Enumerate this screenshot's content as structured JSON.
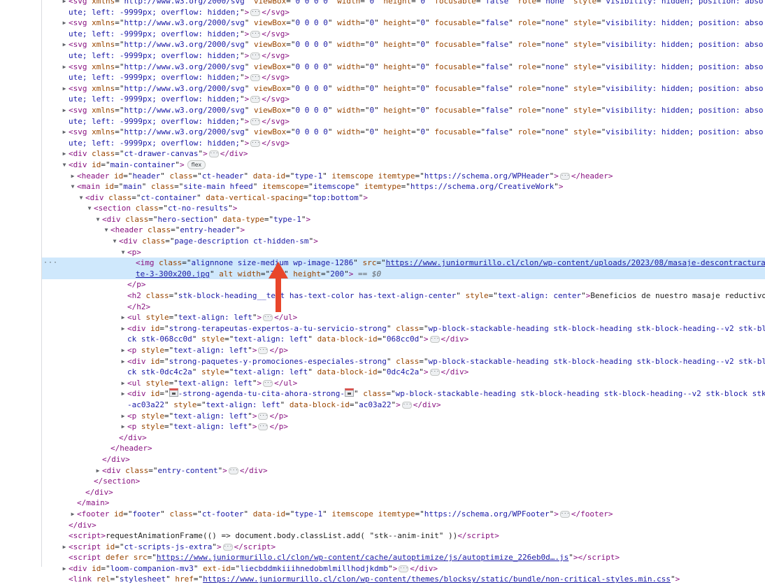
{
  "dom": {
    "rows": [
      {
        "i": 0,
        "t": "c",
        "h": "<span class=\"tag\">&lt;svg</span> <span class=\"an\">xmlns</span>=\"<span class=\"av\">http://www.w3.org/2000/svg</span>\" <span class=\"an\">viewBox</span>=\"<span class=\"av\">0 0 0 0</span>\" <span class=\"an\">width</span>=\"<span class=\"av\">0</span>\" <span class=\"an\">height</span>=\"<span class=\"av\">0</span>\" <span class=\"an\">focusable</span>=\"<span class=\"av\">false</span>\" <span class=\"an\">role</span>=\"<span class=\"av\">none</span>\" <span class=\"an\">style</span>=\"<span class=\"av\">visibility: hidden; position: abso</span>"
      },
      {
        "i": 0,
        "t": "",
        "h": "<span class=\"av\">ute; left: -9999px; overflow: hidden;</span>\"<span class=\"tag\">&gt;</span><span class=\"ell\">···</span><span class=\"tag\">&lt;/svg&gt;</span>"
      },
      {
        "i": 0,
        "t": "c",
        "h": "<span class=\"tag\">&lt;svg</span> <span class=\"an\">xmlns</span>=\"<span class=\"av\">http://www.w3.org/2000/svg</span>\" <span class=\"an\">viewBox</span>=\"<span class=\"av\">0 0 0 0</span>\" <span class=\"an\">width</span>=\"<span class=\"av\">0</span>\" <span class=\"an\">height</span>=\"<span class=\"av\">0</span>\" <span class=\"an\">focusable</span>=\"<span class=\"av\">false</span>\" <span class=\"an\">role</span>=\"<span class=\"av\">none</span>\" <span class=\"an\">style</span>=\"<span class=\"av\">visibility: hidden; position: abso</span>"
      },
      {
        "i": 0,
        "t": "",
        "h": "<span class=\"av\">ute; left: -9999px; overflow: hidden;</span>\"<span class=\"tag\">&gt;</span><span class=\"ell\">···</span><span class=\"tag\">&lt;/svg&gt;</span>"
      },
      {
        "i": 0,
        "t": "c",
        "h": "<span class=\"tag\">&lt;svg</span> <span class=\"an\">xmlns</span>=\"<span class=\"av\">http://www.w3.org/2000/svg</span>\" <span class=\"an\">viewBox</span>=\"<span class=\"av\">0 0 0 0</span>\" <span class=\"an\">width</span>=\"<span class=\"av\">0</span>\" <span class=\"an\">height</span>=\"<span class=\"av\">0</span>\" <span class=\"an\">focusable</span>=\"<span class=\"av\">false</span>\" <span class=\"an\">role</span>=\"<span class=\"av\">none</span>\" <span class=\"an\">style</span>=\"<span class=\"av\">visibility: hidden; position: abso</span>"
      },
      {
        "i": 0,
        "t": "",
        "h": "<span class=\"av\">ute; left: -9999px; overflow: hidden;</span>\"<span class=\"tag\">&gt;</span><span class=\"ell\">···</span><span class=\"tag\">&lt;/svg&gt;</span>"
      },
      {
        "i": 0,
        "t": "c",
        "h": "<span class=\"tag\">&lt;svg</span> <span class=\"an\">xmlns</span>=\"<span class=\"av\">http://www.w3.org/2000/svg</span>\" <span class=\"an\">viewBox</span>=\"<span class=\"av\">0 0 0 0</span>\" <span class=\"an\">width</span>=\"<span class=\"av\">0</span>\" <span class=\"an\">height</span>=\"<span class=\"av\">0</span>\" <span class=\"an\">focusable</span>=\"<span class=\"av\">false</span>\" <span class=\"an\">role</span>=\"<span class=\"av\">none</span>\" <span class=\"an\">style</span>=\"<span class=\"av\">visibility: hidden; position: abso</span>"
      },
      {
        "i": 0,
        "t": "",
        "h": "<span class=\"av\">ute; left: -9999px; overflow: hidden;</span>\"<span class=\"tag\">&gt;</span><span class=\"ell\">···</span><span class=\"tag\">&lt;/svg&gt;</span>"
      },
      {
        "i": 0,
        "t": "c",
        "h": "<span class=\"tag\">&lt;svg</span> <span class=\"an\">xmlns</span>=\"<span class=\"av\">http://www.w3.org/2000/svg</span>\" <span class=\"an\">viewBox</span>=\"<span class=\"av\">0 0 0 0</span>\" <span class=\"an\">width</span>=\"<span class=\"av\">0</span>\" <span class=\"an\">height</span>=\"<span class=\"av\">0</span>\" <span class=\"an\">focusable</span>=\"<span class=\"av\">false</span>\" <span class=\"an\">role</span>=\"<span class=\"av\">none</span>\" <span class=\"an\">style</span>=\"<span class=\"av\">visibility: hidden; position: abso</span>"
      },
      {
        "i": 0,
        "t": "",
        "h": "<span class=\"av\">ute; left: -9999px; overflow: hidden;</span>\"<span class=\"tag\">&gt;</span><span class=\"ell\">···</span><span class=\"tag\">&lt;/svg&gt;</span>"
      },
      {
        "i": 0,
        "t": "c",
        "h": "<span class=\"tag\">&lt;svg</span> <span class=\"an\">xmlns</span>=\"<span class=\"av\">http://www.w3.org/2000/svg</span>\" <span class=\"an\">viewBox</span>=\"<span class=\"av\">0 0 0 0</span>\" <span class=\"an\">width</span>=\"<span class=\"av\">0</span>\" <span class=\"an\">height</span>=\"<span class=\"av\">0</span>\" <span class=\"an\">focusable</span>=\"<span class=\"av\">false</span>\" <span class=\"an\">role</span>=\"<span class=\"av\">none</span>\" <span class=\"an\">style</span>=\"<span class=\"av\">visibility: hidden; position: abso</span>"
      },
      {
        "i": 0,
        "t": "",
        "h": "<span class=\"av\">ute; left: -9999px; overflow: hidden;</span>\"<span class=\"tag\">&gt;</span><span class=\"ell\">···</span><span class=\"tag\">&lt;/svg&gt;</span>"
      },
      {
        "i": 0,
        "t": "c",
        "h": "<span class=\"tag\">&lt;svg</span> <span class=\"an\">xmlns</span>=\"<span class=\"av\">http://www.w3.org/2000/svg</span>\" <span class=\"an\">viewBox</span>=\"<span class=\"av\">0 0 0 0</span>\" <span class=\"an\">width</span>=\"<span class=\"av\">0</span>\" <span class=\"an\">height</span>=\"<span class=\"av\">0</span>\" <span class=\"an\">focusable</span>=\"<span class=\"av\">false</span>\" <span class=\"an\">role</span>=\"<span class=\"av\">none</span>\" <span class=\"an\">style</span>=\"<span class=\"av\">visibility: hidden; position: abso</span>"
      },
      {
        "i": 0,
        "t": "",
        "h": "<span class=\"av\">ute; left: -9999px; overflow: hidden;</span>\"<span class=\"tag\">&gt;</span><span class=\"ell\">···</span><span class=\"tag\">&lt;/svg&gt;</span>"
      },
      {
        "i": 0,
        "t": "c",
        "h": "<span class=\"tag\">&lt;div</span> <span class=\"an\">class</span>=\"<span class=\"av\">ct-drawer-canvas</span>\"<span class=\"tag\">&gt;</span><span class=\"ell\">···</span><span class=\"tag\">&lt;/div&gt;</span>"
      },
      {
        "i": 0,
        "t": "e",
        "h": "<span class=\"tag\">&lt;div</span> <span class=\"an\">id</span>=\"<span class=\"av\">main-container</span>\"<span class=\"tag\">&gt;</span><span class=\"badge\">flex</span>"
      },
      {
        "i": 1,
        "t": "c",
        "h": "<span class=\"tag\">&lt;header</span> <span class=\"an\">id</span>=\"<span class=\"av\">header</span>\" <span class=\"an\">class</span>=\"<span class=\"av\">ct-header</span>\" <span class=\"an\">data-id</span>=\"<span class=\"av\">type-1</span>\" <span class=\"an\">itemscope</span> <span class=\"an\">itemtype</span>=\"<span class=\"av\">https://schema.org/WPHeader</span>\"<span class=\"tag\">&gt;</span><span class=\"ell\">···</span><span class=\"tag\">&lt;/header&gt;</span>"
      },
      {
        "i": 1,
        "t": "e",
        "h": "<span class=\"tag\">&lt;main</span> <span class=\"an\">id</span>=\"<span class=\"av\">main</span>\" <span class=\"an\">class</span>=\"<span class=\"av\">site-main hfeed</span>\" <span class=\"an\">itemscope</span>=\"<span class=\"av\">itemscope</span>\" <span class=\"an\">itemtype</span>=\"<span class=\"av\">https://schema.org/CreativeWork</span>\"<span class=\"tag\">&gt;</span>"
      },
      {
        "i": 2,
        "t": "e",
        "h": "<span class=\"tag\">&lt;div</span> <span class=\"an\">class</span>=\"<span class=\"av\">ct-container</span>\" <span class=\"an\">data-vertical-spacing</span>=\"<span class=\"av\">top:bottom</span>\"<span class=\"tag\">&gt;</span>"
      },
      {
        "i": 3,
        "t": "e",
        "h": "<span class=\"tag\">&lt;section</span> <span class=\"an\">class</span>=\"<span class=\"av\">ct-no-results</span>\"<span class=\"tag\">&gt;</span>"
      },
      {
        "i": 4,
        "t": "e",
        "h": "<span class=\"tag\">&lt;div</span> <span class=\"an\">class</span>=\"<span class=\"av\">hero-section</span>\" <span class=\"an\">data-type</span>=\"<span class=\"av\">type-1</span>\"<span class=\"tag\">&gt;</span>"
      },
      {
        "i": 5,
        "t": "e",
        "h": "<span class=\"tag\">&lt;header</span> <span class=\"an\">class</span>=\"<span class=\"av\">entry-header</span>\"<span class=\"tag\">&gt;</span>"
      },
      {
        "i": 6,
        "t": "e",
        "h": "<span class=\"tag\">&lt;div</span> <span class=\"an\">class</span>=\"<span class=\"av\">page-description ct-hidden-sm</span>\"<span class=\"tag\">&gt;</span>"
      },
      {
        "i": 7,
        "t": "e",
        "h": "<span class=\"tag\">&lt;p&gt;</span>"
      },
      {
        "i": 8,
        "t": "",
        "sel": true,
        "h": "<span class=\"tag\">&lt;img</span> <span class=\"an\">class</span>=\"<span class=\"av\">alignnone size-medium wp-image-1286</span>\" <span class=\"an\">src</span>=\"<span class=\"url\">https://www.juniormurillo.cl/clon/wp-content/uploads/2023/08/masaje-descontractura</span>"
      },
      {
        "i": 8,
        "t": "",
        "sel": true,
        "h": "<span class=\"url\">te-3-300x200.jpg</span>\" <span class=\"an\">alt</span> <span class=\"an\">width</span>=\"<span class=\"av\">300</span>\" <span class=\"an\">height</span>=\"<span class=\"av\">200</span>\"<span class=\"tag\">&gt;</span> <span class=\"eq\">== $0</span>"
      },
      {
        "i": 7,
        "t": "",
        "h": "<span class=\"tag\">&lt;/p&gt;</span>"
      },
      {
        "i": 7,
        "t": "",
        "h": "<span class=\"tag\">&lt;h2</span> <span class=\"an\">class</span>=\"<span class=\"av\">stk-block-heading__text has-text-color has-text-align-center</span>\" <span class=\"an\">style</span>=\"<span class=\"av\">text-align: center</span>\"<span class=\"tag\">&gt;</span><span class=\"tx\">Beneficios de nuestro masaje reductivo</span>"
      },
      {
        "i": 7,
        "t": "",
        "h": "<span class=\"tag\">&lt;/h2&gt;</span>"
      },
      {
        "i": 7,
        "t": "c",
        "h": "<span class=\"tag\">&lt;ul</span> <span class=\"an\">style</span>=\"<span class=\"av\">text-align: left</span>\"<span class=\"tag\">&gt;</span><span class=\"ell\">···</span><span class=\"tag\">&lt;/ul&gt;</span>"
      },
      {
        "i": 7,
        "t": "c",
        "h": "<span class=\"tag\">&lt;div</span> <span class=\"an\">id</span>=\"<span class=\"av\">strong-terapeutas-expertos-a-tu-servicio-strong</span>\" <span class=\"an\">class</span>=\"<span class=\"av\">wp-block-stackable-heading stk-block-heading stk-block-heading--v2 stk-bl</span>"
      },
      {
        "i": 7,
        "t": "",
        "h": "<span class=\"av\">ck stk-068cc0d</span>\" <span class=\"an\">style</span>=\"<span class=\"av\">text-align: left</span>\" <span class=\"an\">data-block-id</span>=\"<span class=\"av\">068cc0d</span>\"<span class=\"tag\">&gt;</span><span class=\"ell\">···</span><span class=\"tag\">&lt;/div&gt;</span>"
      },
      {
        "i": 7,
        "t": "c",
        "h": "<span class=\"tag\">&lt;p</span> <span class=\"an\">style</span>=\"<span class=\"av\">text-align: left</span>\"<span class=\"tag\">&gt;</span><span class=\"ell\">···</span><span class=\"tag\">&lt;/p&gt;</span>"
      },
      {
        "i": 7,
        "t": "c",
        "h": "<span class=\"tag\">&lt;div</span> <span class=\"an\">id</span>=\"<span class=\"av\">strong-paquetes-y-promociones-especiales-strong</span>\" <span class=\"an\">class</span>=\"<span class=\"av\">wp-block-stackable-heading stk-block-heading stk-block-heading--v2 stk-bl</span>"
      },
      {
        "i": 7,
        "t": "",
        "h": "<span class=\"av\">ck stk-0dc4c2a</span>\" <span class=\"an\">style</span>=\"<span class=\"av\">text-align: left</span>\" <span class=\"an\">data-block-id</span>=\"<span class=\"av\">0dc4c2a</span>\"<span class=\"tag\">&gt;</span><span class=\"ell\">···</span><span class=\"tag\">&lt;/div&gt;</span>"
      },
      {
        "i": 7,
        "t": "c",
        "h": "<span class=\"tag\">&lt;ul</span> <span class=\"an\">style</span>=\"<span class=\"av\">text-align: left</span>\"<span class=\"tag\">&gt;</span><span class=\"ell\">···</span><span class=\"tag\">&lt;/ul&gt;</span>"
      },
      {
        "i": 7,
        "t": "c",
        "h": "<span class=\"tag\">&lt;div</span> <span class=\"an\">id</span>=\"<span class=\"emo\" data-name=\"calendar-emoji-icon\" data-interactable=\"false\"></span><span class=\"av\">-strong-agenda-tu-cita-ahora-strong-</span><span class=\"emo\" data-name=\"calendar-emoji-icon\" data-interactable=\"false\"></span>\" <span class=\"an\">class</span>=\"<span class=\"av\">wp-block-stackable-heading stk-block-heading stk-block-heading--v2 stk-block stk</span>"
      },
      {
        "i": 7,
        "t": "",
        "h": "<span class=\"av\">-ac03a22</span>\" <span class=\"an\">style</span>=\"<span class=\"av\">text-align: left</span>\" <span class=\"an\">data-block-id</span>=\"<span class=\"av\">ac03a22</span>\"<span class=\"tag\">&gt;</span><span class=\"ell\">···</span><span class=\"tag\">&lt;/div&gt;</span>"
      },
      {
        "i": 7,
        "t": "c",
        "h": "<span class=\"tag\">&lt;p</span> <span class=\"an\">style</span>=\"<span class=\"av\">text-align: left</span>\"<span class=\"tag\">&gt;</span><span class=\"ell\">···</span><span class=\"tag\">&lt;/p&gt;</span>"
      },
      {
        "i": 7,
        "t": "c",
        "h": "<span class=\"tag\">&lt;p</span> <span class=\"an\">style</span>=\"<span class=\"av\">text-align: left</span>\"<span class=\"tag\">&gt;</span><span class=\"ell\">···</span><span class=\"tag\">&lt;/p&gt;</span>"
      },
      {
        "i": 6,
        "t": "",
        "h": "<span class=\"tag\">&lt;/div&gt;</span>"
      },
      {
        "i": 5,
        "t": "",
        "h": "<span class=\"tag\">&lt;/header&gt;</span>"
      },
      {
        "i": 4,
        "t": "",
        "h": "<span class=\"tag\">&lt;/div&gt;</span>"
      },
      {
        "i": 4,
        "t": "c",
        "h": "<span class=\"tag\">&lt;div</span> <span class=\"an\">class</span>=\"<span class=\"av\">entry-content</span>\"<span class=\"tag\">&gt;</span><span class=\"ell\">···</span><span class=\"tag\">&lt;/div&gt;</span>"
      },
      {
        "i": 3,
        "t": "",
        "h": "<span class=\"tag\">&lt;/section&gt;</span>"
      },
      {
        "i": 2,
        "t": "",
        "h": "<span class=\"tag\">&lt;/div&gt;</span>"
      },
      {
        "i": 1,
        "t": "",
        "h": "<span class=\"tag\">&lt;/main&gt;</span>"
      },
      {
        "i": 1,
        "t": "c",
        "h": "<span class=\"tag\">&lt;footer</span> <span class=\"an\">id</span>=\"<span class=\"av\">footer</span>\" <span class=\"an\">class</span>=\"<span class=\"av\">ct-footer</span>\" <span class=\"an\">data-id</span>=\"<span class=\"av\">type-1</span>\" <span class=\"an\">itemscope</span> <span class=\"an\">itemtype</span>=\"<span class=\"av\">https://schema.org/WPFooter</span>\"<span class=\"tag\">&gt;</span><span class=\"ell\">···</span><span class=\"tag\">&lt;/footer&gt;</span>"
      },
      {
        "i": 0,
        "t": "",
        "h": "<span class=\"tag\">&lt;/div&gt;</span>"
      },
      {
        "i": 0,
        "t": "",
        "h": "<span class=\"tag\">&lt;script&gt;</span><span class=\"tx\">requestAnimationFrame(() =&gt; document.body.classList.add( \"stk--anim-init\" ))</span><span class=\"tag\">&lt;/script&gt;</span>"
      },
      {
        "i": 0,
        "t": "c",
        "h": "<span class=\"tag\">&lt;script</span> <span class=\"an\">id</span>=\"<span class=\"av\">ct-scripts-js-extra</span>\"<span class=\"tag\">&gt;</span><span class=\"ell\">···</span><span class=\"tag\">&lt;/script&gt;</span>"
      },
      {
        "i": 0,
        "t": "",
        "h": "<span class=\"tag\">&lt;script</span> <span class=\"an\">defer</span> <span class=\"an\">src</span>=\"<span class=\"url\">https://www.juniormurillo.cl/clon/wp-content/cache/autoptimize/js/autoptimize_226eb0d….js</span>\"<span class=\"tag\">&gt;&lt;/script&gt;</span>"
      },
      {
        "i": 0,
        "t": "c",
        "h": "<span class=\"tag\">&lt;div</span> <span class=\"an\">id</span>=\"<span class=\"av\">loom-companion-mv3</span>\" <span class=\"an\">ext-id</span>=\"<span class=\"av\">liecbddmkiiihnedobmlmillhodjkdmb</span>\"<span class=\"tag\">&gt;</span><span class=\"ell\">···</span><span class=\"tag\">&lt;/div&gt;</span>"
      },
      {
        "i": 0,
        "t": "",
        "h": "<span class=\"tag\">&lt;link</span> <span class=\"an\">rel</span>=\"<span class=\"av\">stylesheet</span>\" <span class=\"an\">href</span>=\"<span class=\"url\">https://www.juniormurillo.cl/clon/wp-content/themes/blocksy/static/bundle/non-critical-styles.min.css</span>\"<span class=\"tag\">&gt;</span>"
      }
    ],
    "selected_row_marker": "···"
  },
  "colors": {
    "tag": "#881280",
    "attr_name": "#994500",
    "attr_value": "#1a1aa6",
    "selection": "#cfe8fc",
    "arrow": "#e8462b"
  },
  "annotation": {
    "icon": "red-up-arrow-icon"
  }
}
